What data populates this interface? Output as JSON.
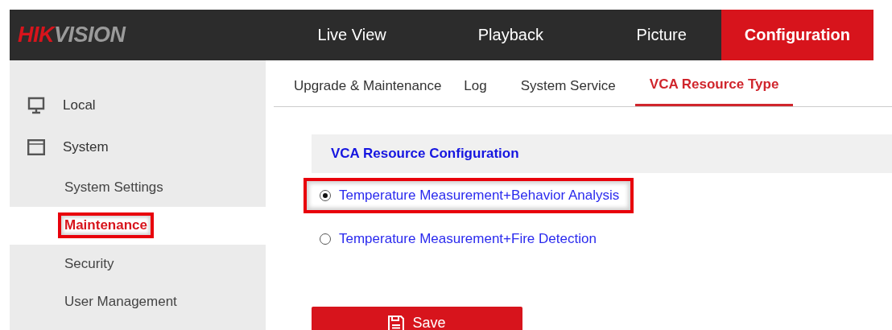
{
  "header": {
    "logo": "HIKVISION",
    "nav": [
      {
        "label": "Live View",
        "selected": false
      },
      {
        "label": "Playback",
        "selected": false
      },
      {
        "label": "Picture",
        "selected": false
      },
      {
        "label": "Configuration",
        "selected": true
      }
    ]
  },
  "sidebar": {
    "items": [
      {
        "label": "Local",
        "kind": "monitor"
      },
      {
        "label": "System",
        "kind": "window",
        "children": [
          {
            "label": "System Settings",
            "selected": false,
            "highlighted": false
          },
          {
            "label": "Maintenance",
            "selected": true,
            "highlighted": true
          },
          {
            "label": "Security",
            "selected": false,
            "highlighted": false
          },
          {
            "label": "User Management",
            "selected": false,
            "highlighted": false
          }
        ]
      }
    ]
  },
  "tabs": [
    {
      "label": "Upgrade & Maintenance",
      "selected": false
    },
    {
      "label": "Log",
      "selected": false
    },
    {
      "label": "System Service",
      "selected": false
    },
    {
      "label": "VCA Resource Type",
      "selected": true
    }
  ],
  "section": {
    "title": "VCA Resource Configuration",
    "options": [
      {
        "label": "Temperature Measurement+Behavior Analysis",
        "selected": true,
        "highlighted": true
      },
      {
        "label": "Temperature Measurement+Fire Detection",
        "selected": false,
        "highlighted": false
      }
    ]
  },
  "save_button": "Save"
}
